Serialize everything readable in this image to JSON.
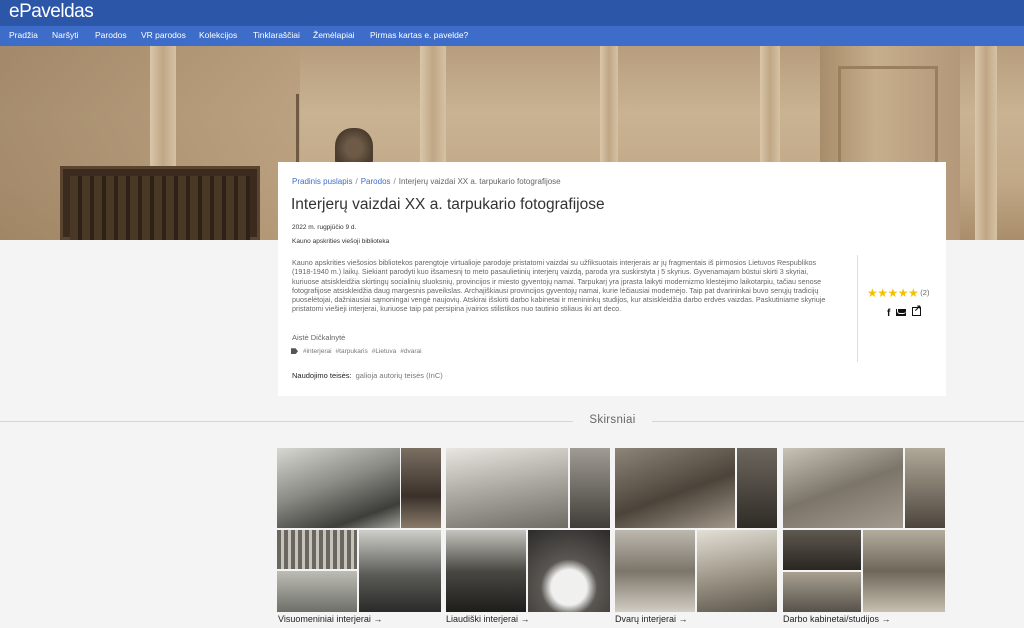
{
  "header": {
    "logo": "ePaveldas",
    "nav": [
      "Pradžia",
      "Naršyti",
      "Parodos",
      "VR parodos",
      "Kolekcijos",
      "Tinklaraščiai",
      "Žemėlapiai",
      "Pirmas kartas e. pavelde?"
    ]
  },
  "breadcrumb": {
    "home": "Pradinis puslapis",
    "sep": "/",
    "exhibitions": "Parodos",
    "current": "Interjerų vaizdai XX a. tarpukario fotografijose"
  },
  "exhibition": {
    "title": "Interjerų vaizdai XX a. tarpukario fotografijose",
    "date": "2022 m. rugpjūčio 9 d.",
    "organization": "Kauno apskrities viešoji biblioteka",
    "description": "Kauno apskrities viešosios bibliotekos parengtoje virtualioje parodoje pristatomi vaizdai su užfiksuotais interjerais ar jų fragmentais iš pirmosios Lietuvos Respublikos (1918-1940 m.) laikų. Siekiant parodyti kuo išsamesnį to meto pasaulietinių interjerų vaizdą, paroda yra suskirstyta į 5 skyrius. Gyvenamajam būstui skirti 3 skyriai, kuriuose atsiskleidžia skirtingų socialinių sluoksnių, provincijos ir miesto gyventojų namai. Tarpukarį yra įprasta laikyti modernizmo klestėjimo laikotarpiu, tačiau senose fotografijose atsiskleidžia daug margesnis paveikslas.  Archajiškiausi provincijos gyventojų namai, kurie lėčiausiai modernėjo. Taip pat dvarininkai buvo senųjų tradicijų puoselėtojai,  dažniausiai sąmoningai vengė naujovių.  Atskirai išskirti darbo kabinetai ir menininkų studijos, kur atsiskleidžia darbo erdvės vaizdas. Paskutiniame skyriuje pristatomi viešieji interjerai, kuriuose taip pat persipina įvairios stilistikos nuo tautinio stiliaus iki art deco.",
    "author": "Aistė Dičkalnytė",
    "tags": [
      "#interjerai",
      "#tarpukaris",
      "#Lietuva",
      "#dvarai"
    ],
    "rights_label": "Naudojimo teisės:",
    "rights_value": "galioja autorių teisės (InC)",
    "rating_stars": "★★★★★",
    "rating_value": 5,
    "rating_count": "(2)"
  },
  "sections": {
    "heading": "Skirsniai",
    "items": [
      {
        "label": "Visuomeniniai interjerai →"
      },
      {
        "label": "Liaudiški interjerai →"
      },
      {
        "label": "Dvarų interjerai →"
      },
      {
        "label": "Darbo kabinetai/studijos →"
      }
    ]
  },
  "colors": {
    "topbar": "#2c56a8",
    "navbar": "#3d6dc8",
    "link": "#3d6dc8",
    "star": "#f2c200"
  },
  "icons": [
    "tag-icon",
    "star-icon",
    "facebook-icon",
    "envelope-icon",
    "external-link-icon",
    "arrow-right-icon"
  ]
}
